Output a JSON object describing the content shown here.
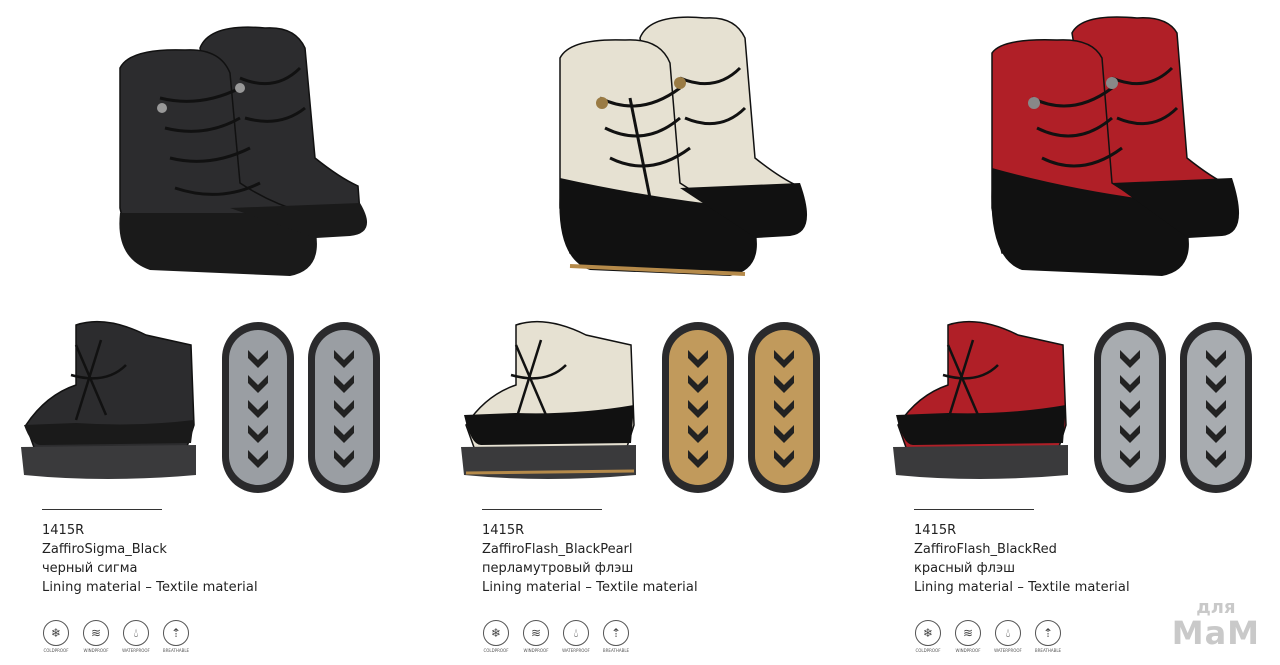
{
  "products": [
    {
      "code": "1415R",
      "model": "ZaffiroSigma_Black",
      "color_name": "черный сигма",
      "lining": "Lining material – Textile material",
      "upper_color": "#2c2c2e",
      "accent_color": "#1a1a1a",
      "sole_tread_color": "#9a9ea3"
    },
    {
      "code": "1415R",
      "model": "ZaffiroFlash_BlackPearl",
      "color_name": "перламутровый флэш",
      "lining": "Lining material – Textile material",
      "upper_color": "#e6e1d2",
      "accent_color": "#111111",
      "sole_tread_color": "#c19a5c"
    },
    {
      "code": "1415R",
      "model": "ZaffiroFlash_BlackRed",
      "color_name": "красный флэш",
      "lining": "Lining material – Textile material",
      "upper_color": "#b01f27",
      "accent_color": "#111111",
      "sole_tread_color": "#a8acb0"
    }
  ],
  "features": [
    {
      "label": "COLDPROOF",
      "icon": "snowflake-icon"
    },
    {
      "label": "WINDPROOF",
      "icon": "wind-icon"
    },
    {
      "label": "WATERPROOF",
      "icon": "water-drop-icon"
    },
    {
      "label": "BREATHABLE",
      "icon": "breathable-icon"
    }
  ],
  "watermark": {
    "line1": "для",
    "line2": "МаМ"
  }
}
